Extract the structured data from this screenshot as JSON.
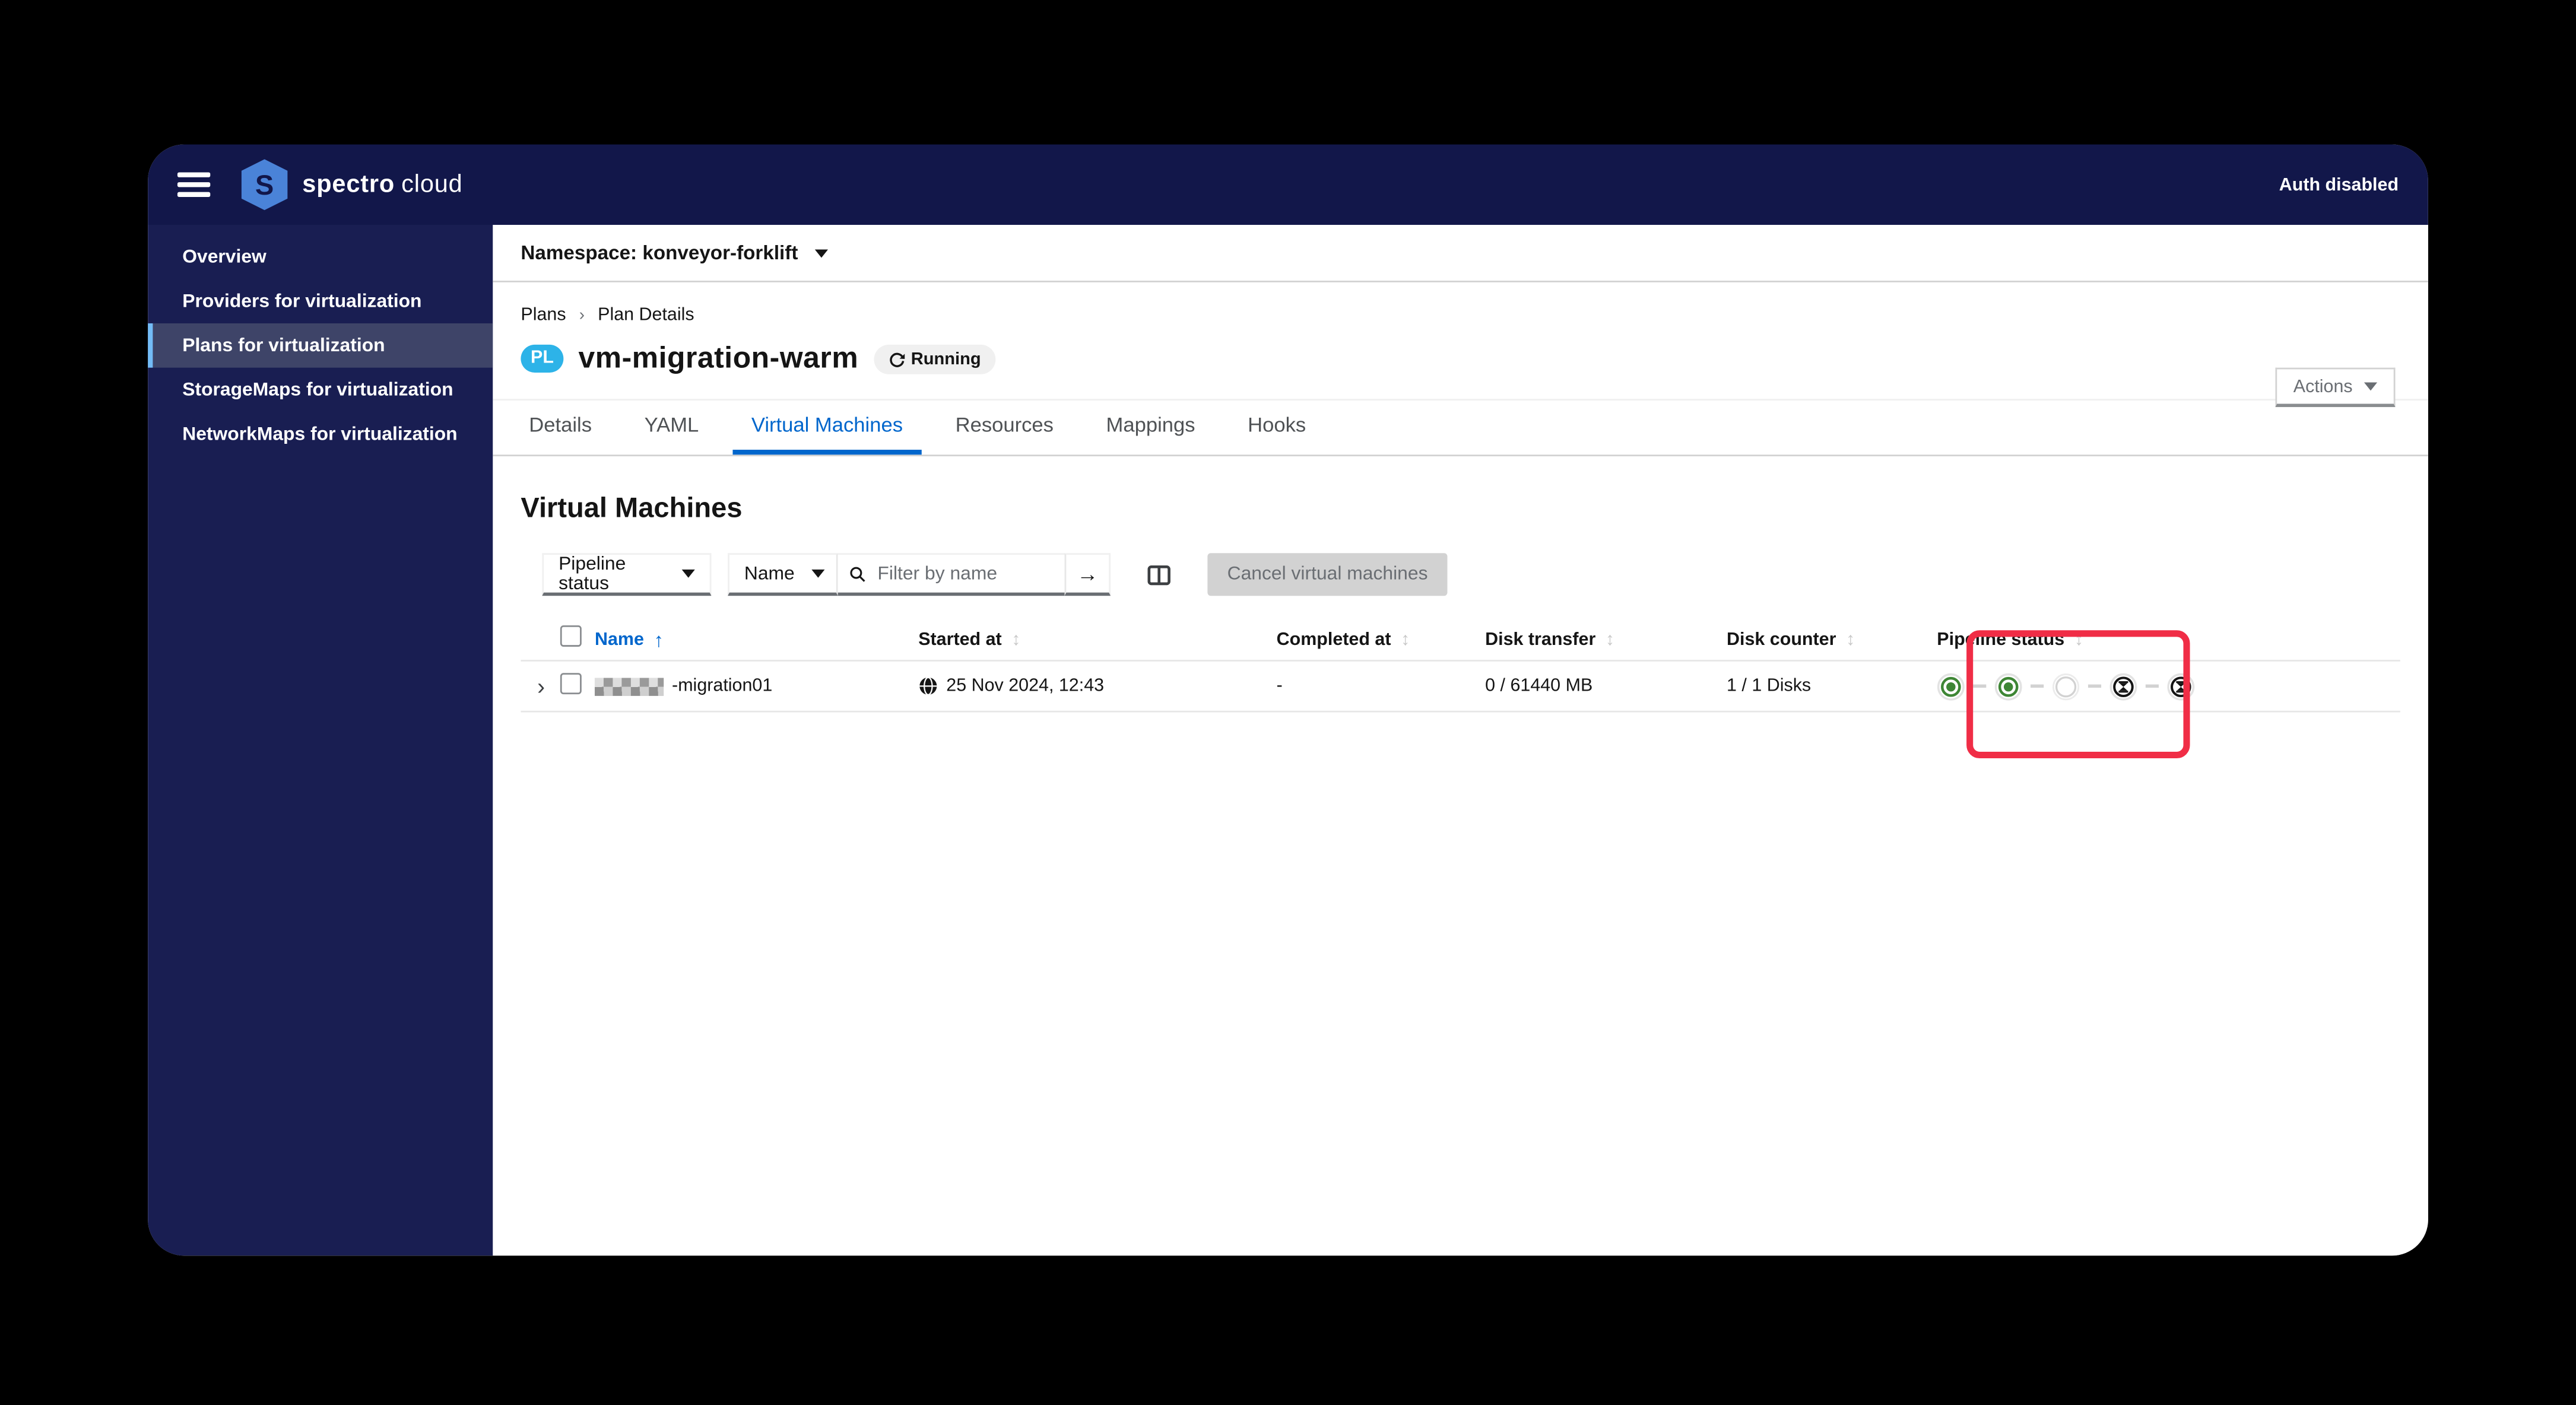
{
  "colors": {
    "masthead_navy": "#12174a",
    "sidebar_navy": "#191e52",
    "sidebar_selected": "#3e4468",
    "sidebar_accent": "#73bcf7",
    "tab_active_blue": "#0066cc",
    "success_green": "#3e8635",
    "badge_cyan": "#2db3e8",
    "highlight_red": "#f02d46",
    "disabled_gray": "#d2d2d2"
  },
  "masthead": {
    "brand_primary": "spectro",
    "brand_secondary": "cloud",
    "auth_label": "Auth disabled"
  },
  "sidebar": {
    "items": [
      {
        "label": "Overview",
        "active": false
      },
      {
        "label": "Providers for virtualization",
        "active": false
      },
      {
        "label": "Plans for virtualization",
        "active": true
      },
      {
        "label": "StorageMaps for virtualization",
        "active": false
      },
      {
        "label": "NetworkMaps for virtualization",
        "active": false
      }
    ]
  },
  "namespace_bar": {
    "label": "Namespace: konveyor-forklift"
  },
  "breadcrumb": {
    "items": [
      "Plans",
      "Plan Details"
    ]
  },
  "page_header": {
    "badge": "PL",
    "title": "vm-migration-warm",
    "status": "Running",
    "actions_label": "Actions"
  },
  "tabs": [
    {
      "label": "Details",
      "active": false
    },
    {
      "label": "YAML",
      "active": false
    },
    {
      "label": "Virtual Machines",
      "active": true
    },
    {
      "label": "Resources",
      "active": false
    },
    {
      "label": "Mappings",
      "active": false
    },
    {
      "label": "Hooks",
      "active": false
    }
  ],
  "section_title": "Virtual Machines",
  "toolbar": {
    "filter_dropdown": "Pipeline status",
    "search_category": "Name",
    "search_placeholder": "Filter by name",
    "search_value": "",
    "cancel_button": "Cancel virtual machines"
  },
  "table": {
    "columns": [
      "Name",
      "Started at",
      "Completed at",
      "Disk transfer",
      "Disk counter",
      "Pipeline status"
    ],
    "sorted_column": "Name",
    "sort_direction": "ascending",
    "rows": [
      {
        "name_redacted_prefix": true,
        "name_suffix": "-migration01",
        "started_at": "25 Nov 2024, 12:43",
        "completed_at": "-",
        "disk_transfer": "0 / 61440 MB",
        "disk_counter": "1 / 1 Disks",
        "pipeline": [
          "completed",
          "completed",
          "not-started",
          "pending",
          "pending"
        ]
      }
    ]
  }
}
